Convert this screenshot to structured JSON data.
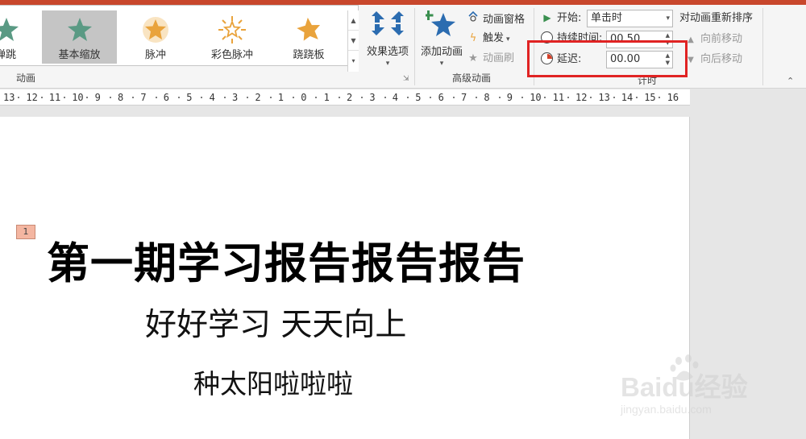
{
  "ribbon": {
    "gallery": {
      "items": [
        {
          "label": "弹跳"
        },
        {
          "label": "基本缩放"
        },
        {
          "label": "脉冲"
        },
        {
          "label": "彩色脉冲"
        },
        {
          "label": "跷跷板"
        }
      ],
      "selected": "基本缩放"
    },
    "effect_options": {
      "label": "效果选项"
    },
    "group_animation": {
      "label": "动画"
    },
    "add_animation": {
      "label": "添加动画"
    },
    "animation_pane": {
      "label": "动画窗格"
    },
    "trigger": {
      "label": "触发"
    },
    "animation_painter": {
      "label": "动画刷"
    },
    "group_advanced": {
      "label": "高级动画"
    },
    "timing": {
      "start_label": "开始:",
      "start_value": "单击时",
      "duration_label": "持续时间:",
      "duration_value": "00.50",
      "delay_label": "延迟:",
      "delay_value": "00.00",
      "group_label": "计时"
    },
    "reorder": {
      "title": "对动画重新排序",
      "move_earlier": "向前移动",
      "move_later": "向后移动"
    }
  },
  "ruler": {
    "labels": [
      "13",
      "12",
      "11",
      "10",
      "9",
      "8",
      "7",
      "6",
      "5",
      "4",
      "3",
      "2",
      "1",
      "0",
      "1",
      "2",
      "3",
      "4",
      "5",
      "6",
      "7",
      "8",
      "9",
      "10",
      "11",
      "12",
      "13",
      "14",
      "15",
      "16"
    ]
  },
  "slide": {
    "animation_tag": "1",
    "title": "第一期学习报告报告报告",
    "subtitle1": "好好学习 天天向上",
    "subtitle2": "种太阳啦啦啦"
  },
  "watermark": {
    "text": "Baidu经验",
    "sub": "jingyan.baidu.com"
  },
  "colors": {
    "accent": "#c8472c",
    "highlight_box": "#e02323",
    "star_green": "#5a9a84",
    "star_gold": "#e9a33c"
  }
}
